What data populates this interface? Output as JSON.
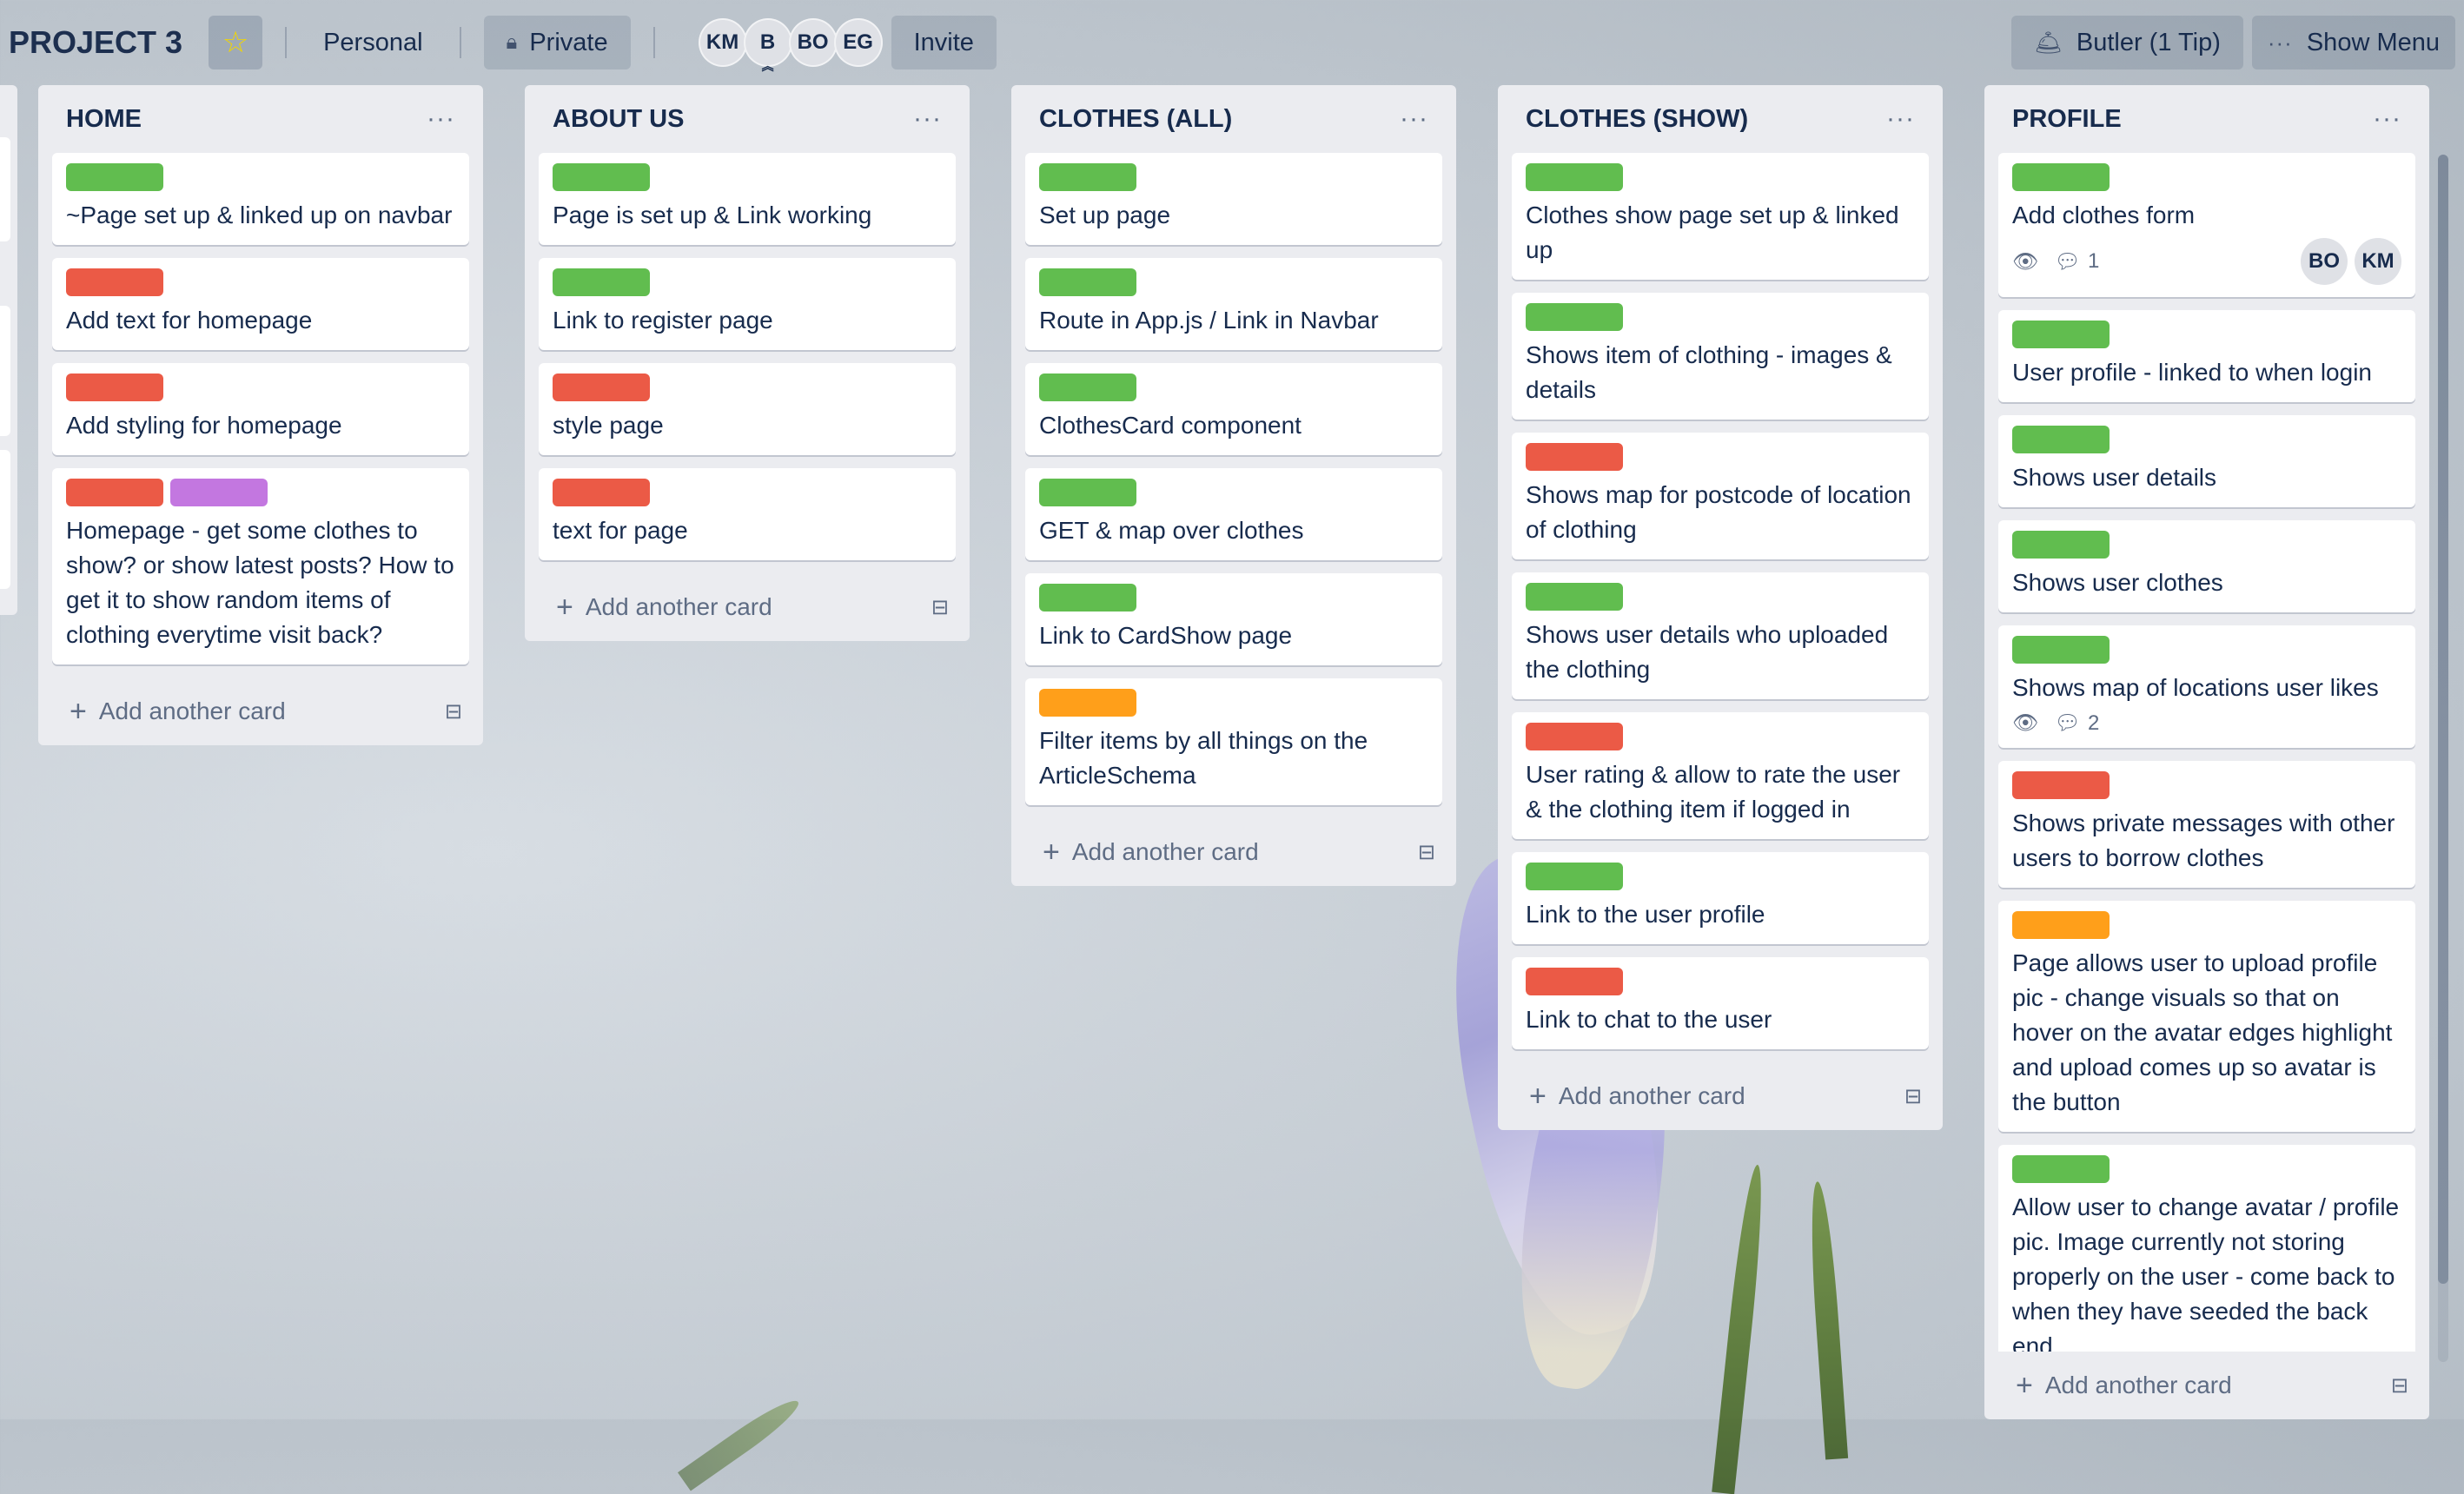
{
  "header": {
    "board_title": "PROJECT 3",
    "star_icon": "star-icon",
    "workspace": "Personal",
    "visibility": "Private",
    "members": [
      "KM",
      "B",
      "BO",
      "EG"
    ],
    "invite": "Invite",
    "butler": "Butler (1 Tip)",
    "menu": "Show Menu",
    "menu_dots": "···"
  },
  "list_menu_glyph": "···",
  "add_card_label": "Add another card",
  "colors": {
    "green": "#61bd4f",
    "red": "#eb5a46",
    "purple": "#c377e0",
    "orange": "#ff9f1a",
    "list_bg": "#ebecf0"
  },
  "lists": [
    {
      "title": "HOME",
      "cards": [
        {
          "labels": [
            "green"
          ],
          "title": "~Page set up & linked up on navbar"
        },
        {
          "labels": [
            "red"
          ],
          "title": "Add text for homepage"
        },
        {
          "labels": [
            "red"
          ],
          "title": "Add styling for homepage"
        },
        {
          "labels": [
            "red",
            "purple"
          ],
          "title": "Homepage - get some clothes to show? or show latest posts? How to get it to show random items of clothing everytime visit back?"
        }
      ]
    },
    {
      "title": "ABOUT US",
      "cards": [
        {
          "labels": [
            "green"
          ],
          "title": "Page is set up & Link working"
        },
        {
          "labels": [
            "green"
          ],
          "title": "Link to register page"
        },
        {
          "labels": [
            "red"
          ],
          "title": "style page"
        },
        {
          "labels": [
            "red"
          ],
          "title": "text for page"
        }
      ]
    },
    {
      "title": "CLOTHES (ALL)",
      "cards": [
        {
          "labels": [
            "green"
          ],
          "title": "Set up page"
        },
        {
          "labels": [
            "green"
          ],
          "title": "Route in App.js / Link in Navbar"
        },
        {
          "labels": [
            "green"
          ],
          "title": "ClothesCard component"
        },
        {
          "labels": [
            "green"
          ],
          "title": "GET & map over clothes"
        },
        {
          "labels": [
            "green"
          ],
          "title": "Link to CardShow page"
        },
        {
          "labels": [
            "orange"
          ],
          "title": "Filter items by all things on the ArticleSchema"
        }
      ]
    },
    {
      "title": "CLOTHES (SHOW)",
      "cards": [
        {
          "labels": [
            "green"
          ],
          "title": "Clothes show page set up & linked up"
        },
        {
          "labels": [
            "green"
          ],
          "title": "Shows item of clothing - images & details"
        },
        {
          "labels": [
            "red"
          ],
          "title": "Shows map for postcode of location of clothing"
        },
        {
          "labels": [
            "green"
          ],
          "title": "Shows user details who uploaded the clothing"
        },
        {
          "labels": [
            "red"
          ],
          "title": "User rating & allow to rate the user & the clothing item if logged in"
        },
        {
          "labels": [
            "green"
          ],
          "title": "Link to the user profile"
        },
        {
          "labels": [
            "red"
          ],
          "title": "Link to chat to the user"
        }
      ]
    },
    {
      "title": "PROFILE",
      "cards": [
        {
          "labels": [
            "green"
          ],
          "title": "Add clothes form",
          "comments": "1",
          "members": [
            "BO",
            "KM"
          ]
        },
        {
          "labels": [
            "green"
          ],
          "title": "User profile - linked to when login"
        },
        {
          "labels": [
            "green"
          ],
          "title": "Shows user details"
        },
        {
          "labels": [
            "green"
          ],
          "title": "Shows user clothes"
        },
        {
          "labels": [
            "green"
          ],
          "title": "Shows map of locations user likes",
          "comments": "2"
        },
        {
          "labels": [
            "red"
          ],
          "title": "Shows private messages with other users to borrow clothes"
        },
        {
          "labels": [
            "orange"
          ],
          "title": "Page allows user to upload profile pic - change visuals so that on hover on the avatar edges highlight and upload comes up so avatar is the button"
        },
        {
          "labels": [
            "green"
          ],
          "title": "Allow user to change avatar / profile pic. Image currently not storing properly on the user - come back to when they have seeded the back end"
        }
      ]
    }
  ]
}
